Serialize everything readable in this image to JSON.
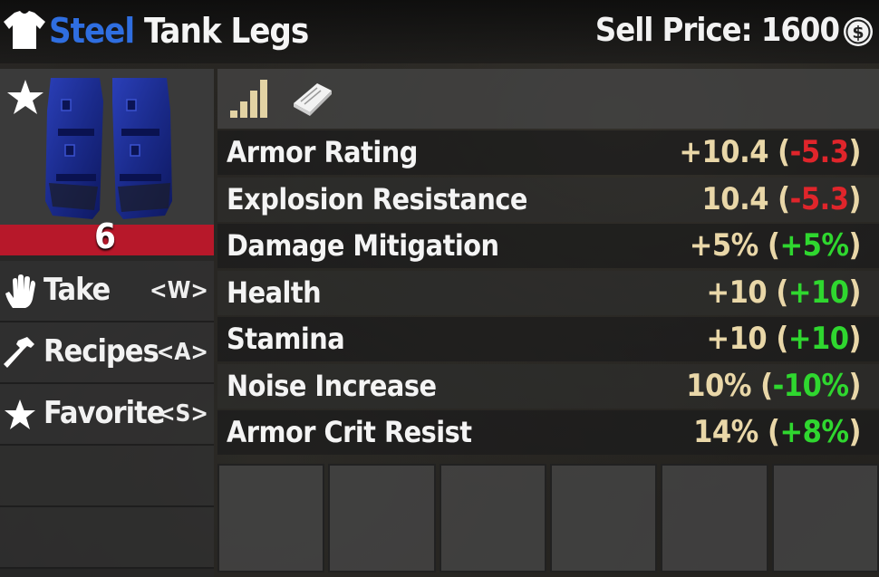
{
  "header": {
    "material": "Steel",
    "item_name": "Tank Legs",
    "sell_label": "Sell Price: 1600",
    "shirt_icon": "shirt-icon",
    "coin_icon": "coin-icon"
  },
  "item": {
    "quality": "6",
    "quality_color": "#b7182a",
    "favorite_icon": "star-icon"
  },
  "actions": [
    {
      "label": "Take",
      "key": "<W>",
      "icon": "hand-icon"
    },
    {
      "label": "Recipes",
      "key": "<A>",
      "icon": "hammer-icon"
    },
    {
      "label": "Favorite",
      "key": "<S>",
      "icon": "star-icon"
    }
  ],
  "toolbar": {
    "tier_icon": "signal-bars-icon",
    "book_icon": "book-icon"
  },
  "stats": [
    {
      "name": "Armor Rating",
      "value": "+10.4",
      "delta": "-5.3",
      "delta_type": "neg"
    },
    {
      "name": "Explosion Resistance",
      "value": "10.4",
      "delta": "-5.3",
      "delta_type": "neg"
    },
    {
      "name": "Damage Mitigation",
      "value": "+5%",
      "delta": "+5%",
      "delta_type": "pos"
    },
    {
      "name": "Health",
      "value": "+10",
      "delta": "+10",
      "delta_type": "pos"
    },
    {
      "name": "Stamina",
      "value": "+10",
      "delta": "+10",
      "delta_type": "pos"
    },
    {
      "name": "Noise Increase",
      "value": "10%",
      "delta": "-10%",
      "delta_type": "pos"
    },
    {
      "name": "Armor Crit Resist",
      "value": "14%",
      "delta": "+8%",
      "delta_type": "pos"
    }
  ],
  "mod_slots": 6,
  "colors": {
    "material": "#2f6ee0",
    "value": "#e9d7a8",
    "negative": "#e0252b",
    "positive": "#2fd72f"
  }
}
